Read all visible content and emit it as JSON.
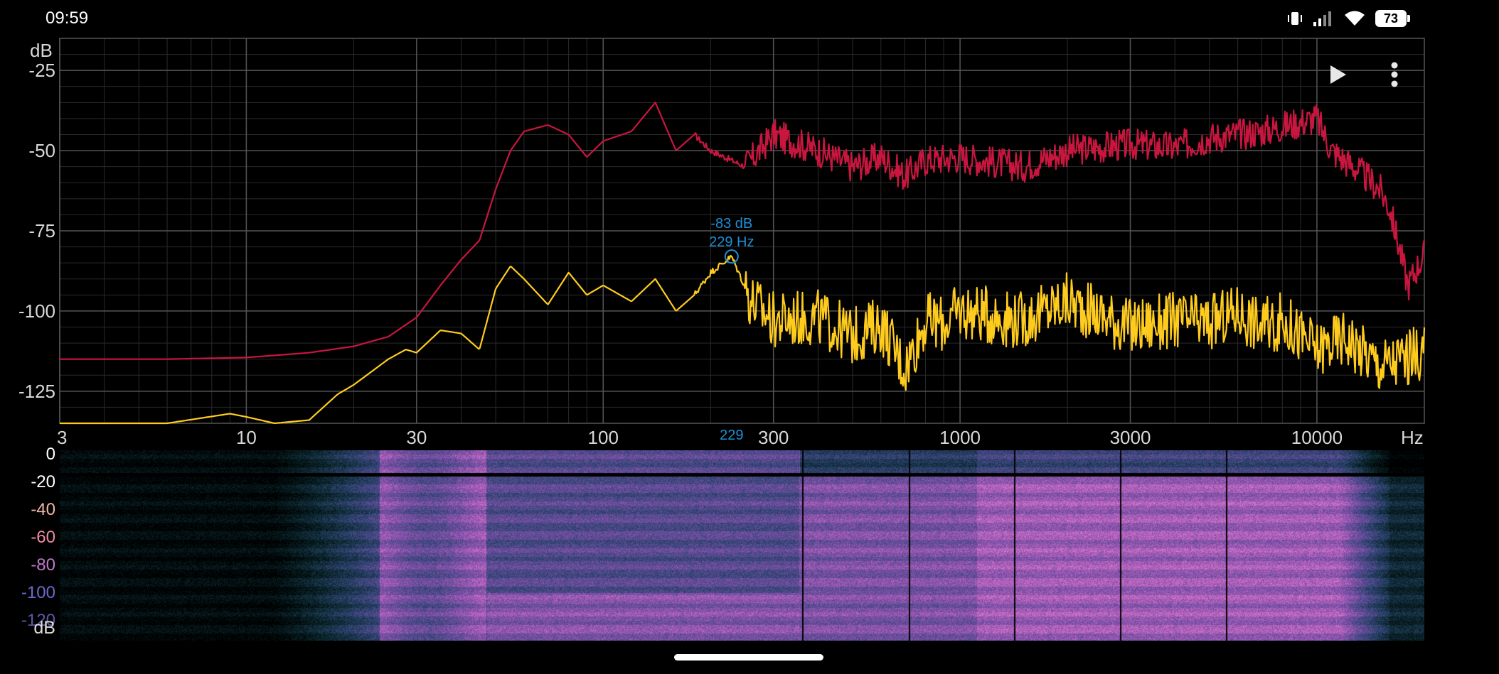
{
  "status_bar": {
    "time": "09:59",
    "battery": "73",
    "icons": [
      "vibrate-icon",
      "signal-icon",
      "wifi-icon",
      "battery-icon"
    ]
  },
  "toolbar": {
    "play_icon": "play-icon",
    "more_icon": "more-vert-icon"
  },
  "colors": {
    "background": "#000000",
    "grid": "#3a3a3a",
    "peak_trace": "#c8163e",
    "live_trace": "#ffcc1e",
    "cursor": "#1e90d6",
    "label": "#d8d8d8"
  },
  "cursor": {
    "db_label": "-83 dB",
    "hz_label": "229 Hz",
    "axis_label": "229",
    "freq": 229,
    "db": -83
  },
  "spectrogram": {
    "db_labels": [
      "0",
      "-20",
      "-40",
      "-60",
      "-80",
      "-100",
      "-120"
    ],
    "db_label_colors": [
      "#ffffff",
      "#ffffff",
      "#f0b8a8",
      "#ee8aa8",
      "#c07acc",
      "#6a6ad0",
      "#5a5aaa"
    ],
    "unit": "dB"
  },
  "chart_data": {
    "type": "line",
    "ylabel": "dB",
    "xlabel": "Hz",
    "x_scale": "log",
    "xlim": [
      3,
      20000
    ],
    "ylim": [
      -135,
      -15
    ],
    "x_ticks": [
      3,
      10,
      30,
      100,
      300,
      1000,
      3000,
      10000
    ],
    "x_tick_labels": [
      "3",
      "10",
      "30",
      "100",
      "300",
      "1000",
      "3000",
      "10000"
    ],
    "y_ticks": [
      -25,
      -50,
      -75,
      -100,
      -125
    ],
    "y_tick_labels": [
      "-25",
      "-50",
      "-75",
      "-100",
      "-125"
    ],
    "series": [
      {
        "color": "#c8163e",
        "x": [
          3,
          6,
          10,
          15,
          20,
          25,
          30,
          35,
          40,
          45,
          50,
          55,
          60,
          70,
          80,
          90,
          100,
          120,
          140,
          160,
          180,
          200,
          250,
          300,
          400,
          500,
          600,
          700,
          800,
          1000,
          1500,
          2000,
          3000,
          4000,
          5000,
          7000,
          10000,
          11000,
          13000,
          15000,
          16000,
          17000,
          18000,
          20000
        ],
        "values": [
          -115,
          -115,
          -114.5,
          -113,
          -111,
          -108,
          -102,
          -92,
          -84,
          -78,
          -62,
          -50,
          -44,
          -42,
          -45,
          -52,
          -47,
          -44,
          -35,
          -50,
          -45,
          -50,
          -55,
          -45,
          -50,
          -55,
          -52,
          -58,
          -53,
          -52,
          -55,
          -50,
          -48,
          -49,
          -46,
          -44,
          -40,
          -50,
          -56,
          -62,
          -68,
          -80,
          -92,
          -82
        ]
      },
      {
        "color": "#ffcc1e",
        "x": [
          3,
          6,
          9,
          10,
          12,
          15,
          18,
          20,
          25,
          28,
          30,
          35,
          40,
          45,
          50,
          55,
          60,
          70,
          80,
          90,
          100,
          120,
          140,
          160,
          180,
          200,
          229,
          260,
          300,
          400,
          500,
          600,
          700,
          800,
          900,
          1000,
          1500,
          2000,
          3000,
          4000,
          5000,
          6000,
          7000,
          8000,
          10000,
          12000,
          15000,
          20000
        ],
        "values": [
          -135,
          -135,
          -132,
          -133,
          -135,
          -134,
          -126,
          -123,
          -115,
          -112,
          -113,
          -106,
          -107,
          -112,
          -93,
          -86,
          -90,
          -98,
          -88,
          -95,
          -92,
          -97,
          -90,
          -100,
          -95,
          -88,
          -83,
          -97,
          -103,
          -102,
          -108,
          -104,
          -118,
          -103,
          -104,
          -100,
          -103,
          -97,
          -105,
          -103,
          -104,
          -100,
          -105,
          -103,
          -112,
          -108,
          -117,
          -113
        ]
      }
    ]
  }
}
